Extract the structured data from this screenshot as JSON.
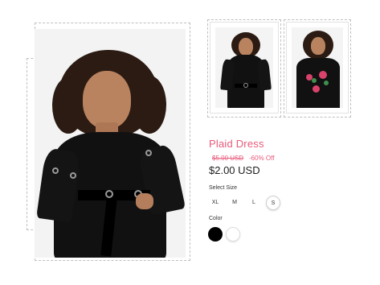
{
  "product": {
    "title": "Plaid Dress",
    "original_price": "$5.00 USD",
    "discount": "-60% Off",
    "price": "$2.00 USD"
  },
  "size": {
    "label": "Select Size",
    "options": [
      "XL",
      "M",
      "L",
      "S"
    ],
    "selected": "S"
  },
  "color": {
    "label": "Color",
    "options": [
      {
        "name": "black",
        "hex": "#000000",
        "selected": true
      },
      {
        "name": "white",
        "hex": "#ffffff",
        "selected": false
      }
    ]
  },
  "colors": {
    "accent": "#e85a7a",
    "dress_black": "#111111",
    "embroidery_pink": "#d9436b",
    "embroidery_green": "#3f8f4e"
  },
  "gallery": {
    "main_image": "model-black-dress-front-photo",
    "thumbnails": [
      "model-black-dress-photo",
      "model-black-floral-top-photo"
    ]
  }
}
